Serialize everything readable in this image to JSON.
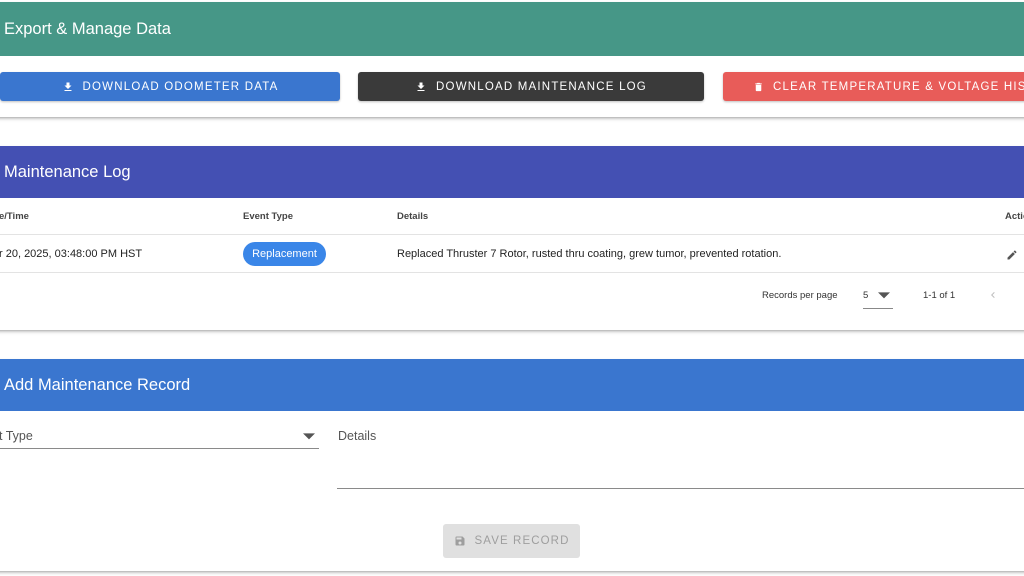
{
  "export": {
    "title": "Export & Manage Data",
    "download_odometer_label": "DOWNLOAD ODOMETER DATA",
    "download_maintenance_label": "DOWNLOAD MAINTENANCE LOG",
    "clear_history_label": "CLEAR TEMPERATURE & VOLTAGE HISTORY",
    "colors": {
      "header": "#469787",
      "download_odometer": "#3a76cf",
      "download_maintenance": "#3a3a3a",
      "clear_history": "#e85c59"
    }
  },
  "log": {
    "title": "Maintenance Log",
    "columns": [
      "e/Time",
      "Event Type",
      "Details",
      "Actio"
    ],
    "rows": [
      {
        "datetime": "r 20, 2025, 03:48:00 PM HST",
        "event_type": "Replacement",
        "details": "Replaced Thruster 7 Rotor, rusted thru coating, grew tumor, prevented rotation."
      }
    ],
    "footer": {
      "records_per_page_label": "Records per page",
      "records_per_page_value": "5",
      "range_text": "1-1 of 1"
    },
    "colors": {
      "header": "#4450b3",
      "chip": "#3a86e8"
    }
  },
  "add": {
    "title": "Add Maintenance Record",
    "event_type_label": "t Type",
    "details_label": "Details",
    "save_label": "SAVE RECORD",
    "colors": {
      "header": "#3a76cf"
    }
  }
}
